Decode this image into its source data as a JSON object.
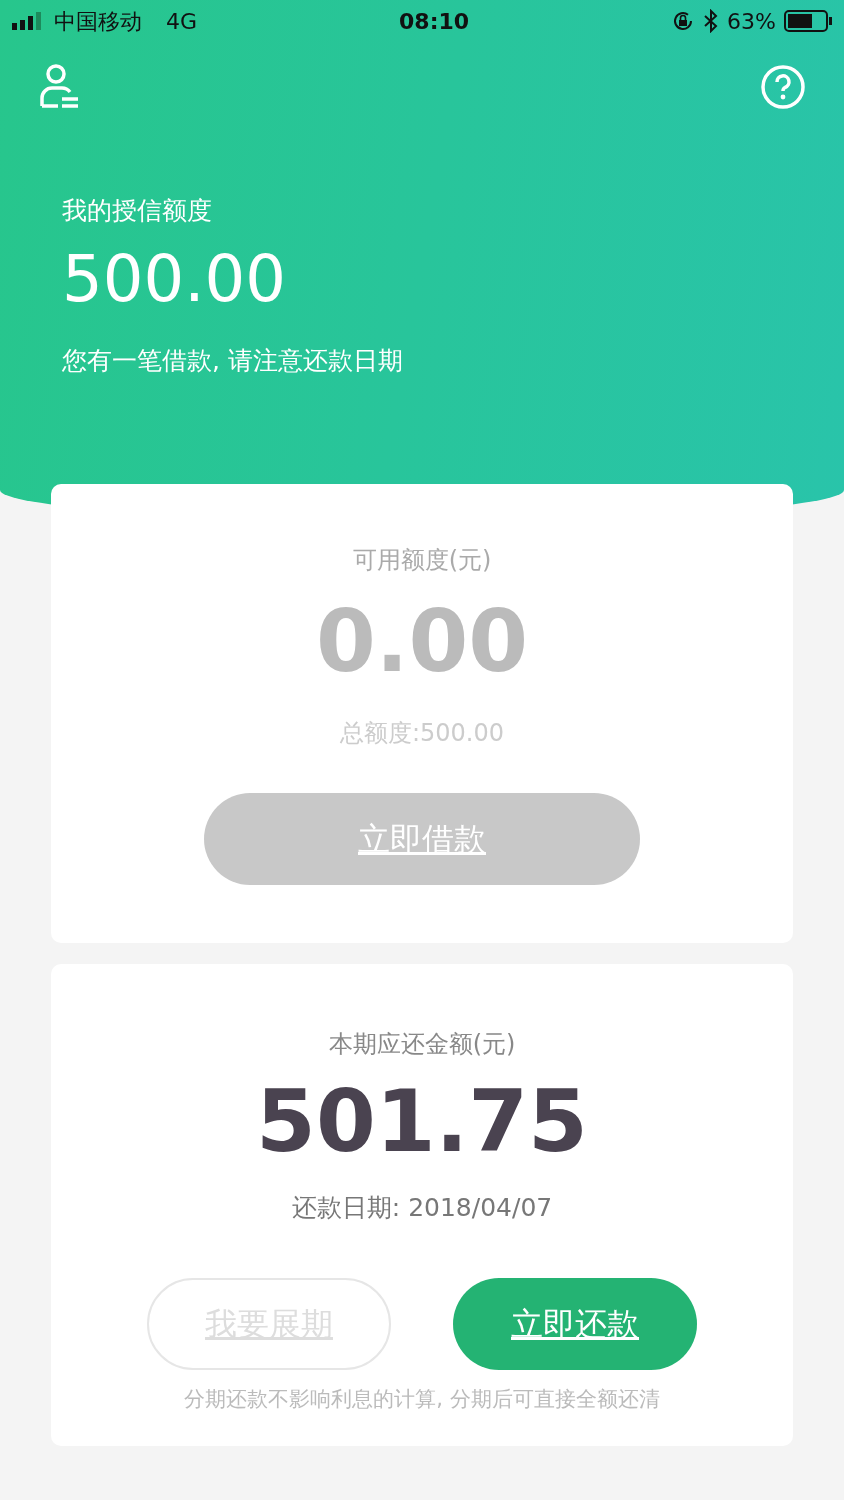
{
  "status_bar": {
    "carrier": "中国移动",
    "network": "4G",
    "time": "08:10",
    "battery": "63%"
  },
  "header": {
    "title": "我的授信额度",
    "amount": "500.00",
    "notice": "您有一笔借款, 请注意还款日期"
  },
  "credit_card": {
    "label": "可用额度(元)",
    "amount": "0.00",
    "total": "总额度:500.00",
    "button": {
      "label": "立即借款",
      "disabled": true
    }
  },
  "repay_card": {
    "label": "本期应还金额(元)",
    "amount": "501.75",
    "due_date": "还款日期: 2018/04/07",
    "buttons": [
      {
        "label": "我要展期",
        "kind": "outline",
        "disabled": true
      },
      {
        "label": "立即还款",
        "kind": "solid",
        "disabled": false
      }
    ],
    "footnote": "分期还款不影响利息的计算, 分期后可直接全额还清"
  }
}
